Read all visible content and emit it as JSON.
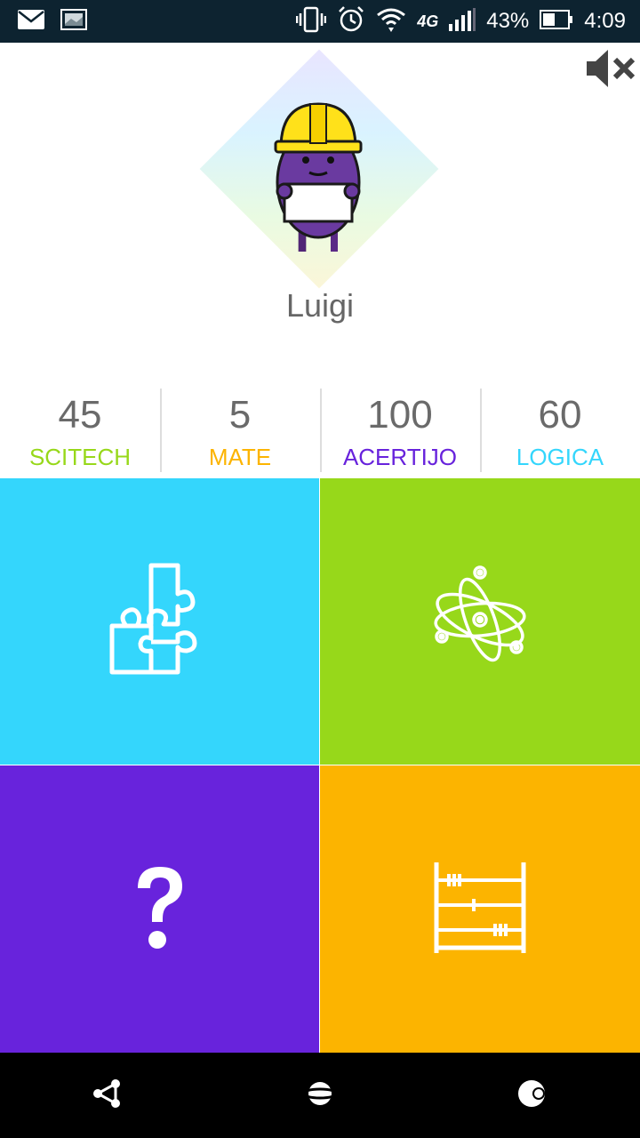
{
  "status_bar": {
    "battery_percent": "43%",
    "time": "4:09",
    "network": "4G",
    "icons": [
      "mail-icon",
      "image-icon",
      "vibrate-icon",
      "alarm-icon",
      "wifi-icon",
      "signal-icon",
      "battery-icon"
    ]
  },
  "header": {
    "mute_icon": "volume-mute-icon",
    "avatar_icon": "purple-mascot-hardhat",
    "username": "Luigi"
  },
  "scores": [
    {
      "value": "45",
      "label": "SCITECH",
      "color": "#97d81a"
    },
    {
      "value": "5",
      "label": "MATE",
      "color": "#fcb400"
    },
    {
      "value": "100",
      "label": "ACERTIJO",
      "color": "#6823dc"
    },
    {
      "value": "60",
      "label": "LOGICA",
      "color": "#34d6fc"
    }
  ],
  "tiles": [
    {
      "icon": "puzzle-icon",
      "color": "#34d6fc"
    },
    {
      "icon": "atom-icon",
      "color": "#97d81a"
    },
    {
      "icon": "question-mark-icon",
      "color": "#6823dc"
    },
    {
      "icon": "abacus-icon",
      "color": "#fcb400"
    }
  ],
  "nav": {
    "icons": [
      "share-icon",
      "planet-icon",
      "moon-icon"
    ]
  }
}
